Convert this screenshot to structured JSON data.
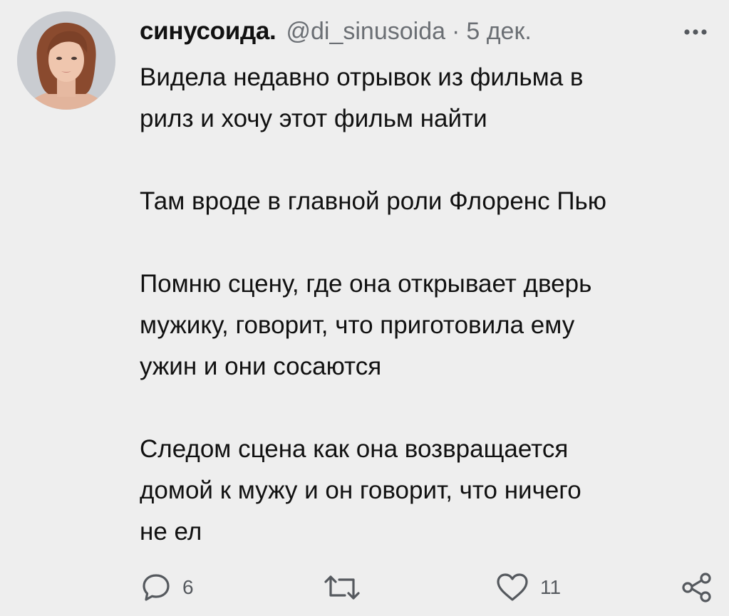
{
  "tweet": {
    "author": {
      "name": "синусоида.",
      "handle": "@di_sinusoida",
      "separator": "·",
      "date": "5 дек."
    },
    "body": {
      "paragraphs": [
        [
          "Видела недавно отрывок из фильма в",
          "рилз и хочу этот фильм найти"
        ],
        [
          "Там вроде в главной роли Флоренс Пью"
        ],
        [
          "Помню сцену, где она открывает дверь",
          "мужику, говорит, что приготовила ему",
          "ужин и они сосаются"
        ],
        [
          "Следом сцена как она возвращается",
          "домой к мужу и он говорит, что ничего",
          "не ел"
        ]
      ]
    },
    "actions": {
      "reply_count": "6",
      "retweet_count": "",
      "like_count": "11"
    },
    "icons": {
      "more": "more-dots-icon",
      "reply": "reply-bubble-icon",
      "retweet": "retweet-arrows-icon",
      "like": "heart-icon",
      "share": "share-nodes-icon"
    },
    "colors": {
      "background": "#eeeeee",
      "text": "#111111",
      "secondary_text": "#6b6f74",
      "icon": "#55595e"
    }
  }
}
